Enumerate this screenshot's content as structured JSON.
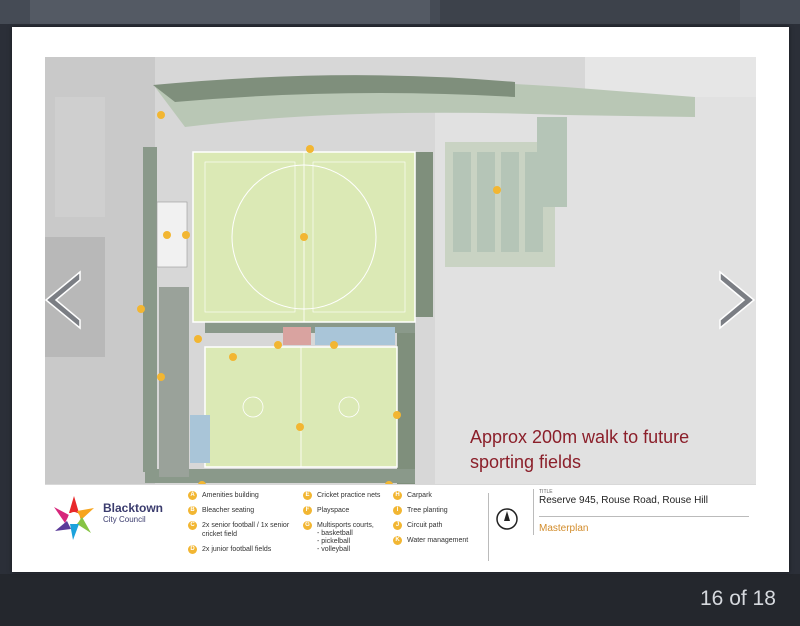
{
  "viewer": {
    "counter": "16 of 18",
    "prev_icon": "chevron-left-icon",
    "next_icon": "chevron-right-icon"
  },
  "slide": {
    "annotation_line1": "Approx 200m walk to future",
    "annotation_line2": "sporting fields",
    "council_name": "Blacktown",
    "council_sub": "City Council",
    "title_label": "TITLE",
    "title": "Reserve 945, Rouse Road, Rouse Hill",
    "subtitle": "Masterplan",
    "legend": [
      {
        "key": "A",
        "label": "Amenities building"
      },
      {
        "key": "B",
        "label": "Bleacher seating"
      },
      {
        "key": "C",
        "label": "2x senior football / 1x senior cricket field"
      },
      {
        "key": "D",
        "label": "2x junior football fields"
      },
      {
        "key": "E",
        "label": "Cricket practice nets"
      },
      {
        "key": "F",
        "label": "Playspace"
      },
      {
        "key": "G",
        "label": "Multisports courts,"
      },
      {
        "key": "H",
        "label": "Carpark"
      },
      {
        "key": "I",
        "label": "Tree planting"
      },
      {
        "key": "J",
        "label": "Circuit path"
      },
      {
        "key": "K",
        "label": "Water management"
      }
    ],
    "legend_g_subitems": [
      "- basketball",
      "- pickelball",
      "- volleyball"
    ]
  },
  "colors": {
    "accent_marker": "#f2b632",
    "annotation": "#8b1f2a",
    "field": "#dbe9b5",
    "tree": "#7f8f7c"
  }
}
